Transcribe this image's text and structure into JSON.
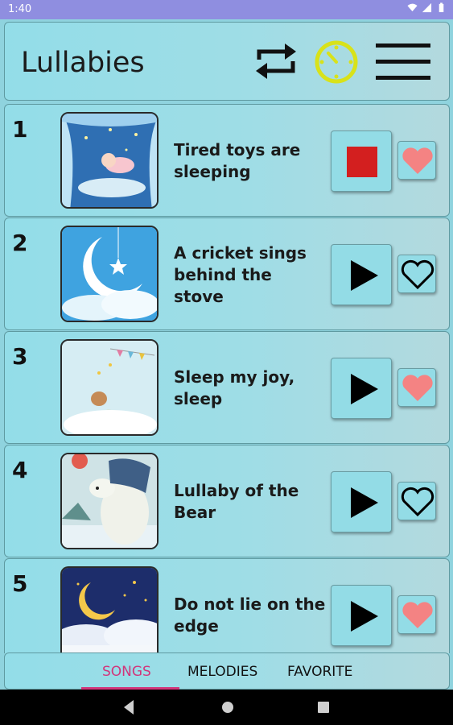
{
  "status_bar": {
    "time": "1:40"
  },
  "header": {
    "title": "Lullabies"
  },
  "songs": [
    {
      "number": "1",
      "title": "Tired toys are sleeping",
      "state": "playing",
      "favorite": true
    },
    {
      "number": "2",
      "title": "A cricket sings behind the stove",
      "state": "stopped",
      "favorite": false
    },
    {
      "number": "3",
      "title": "Sleep my joy, sleep",
      "state": "stopped",
      "favorite": true
    },
    {
      "number": "4",
      "title": "Lullaby of the Bear",
      "state": "stopped",
      "favorite": false
    },
    {
      "number": "5",
      "title": "Do not lie on the edge",
      "state": "stopped",
      "favorite": true
    }
  ],
  "tabs": [
    {
      "label": "SONGS",
      "active": true
    },
    {
      "label": "MELODIES",
      "active": false
    },
    {
      "label": "FAVORITE",
      "active": false
    }
  ],
  "colors": {
    "accent": "#d2357a",
    "heart_fill": "#f48383",
    "stop": "#d31f1f",
    "timer": "#d8e21a"
  }
}
